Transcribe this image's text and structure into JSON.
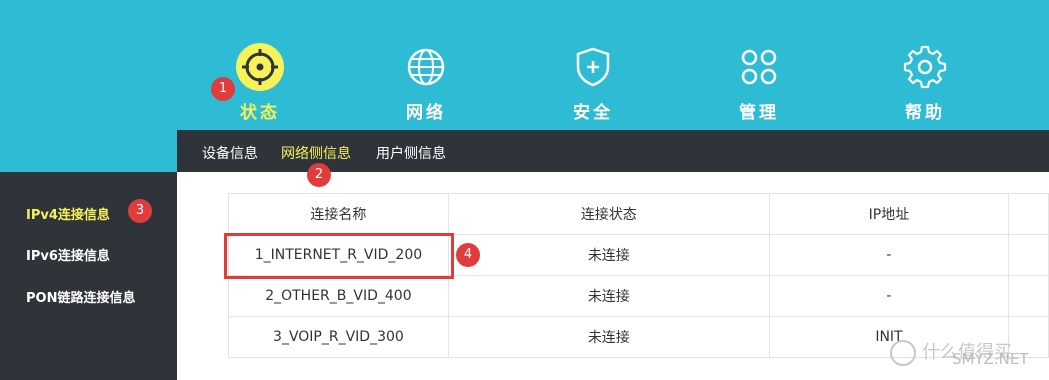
{
  "nav": {
    "items": [
      {
        "label": "状态",
        "icon": "status-target-icon",
        "active": true
      },
      {
        "label": "网络",
        "icon": "globe-icon",
        "active": false
      },
      {
        "label": "安全",
        "icon": "shield-plus-icon",
        "active": false
      },
      {
        "label": "管理",
        "icon": "manage-grid-icon",
        "active": false
      },
      {
        "label": "帮助",
        "icon": "gear-icon",
        "active": false
      }
    ]
  },
  "subnav": {
    "items": [
      "设备信息",
      "网络侧信息",
      "用户侧信息"
    ],
    "active": "网络侧信息"
  },
  "sidebar": {
    "items": [
      "IPv4连接信息",
      "IPv6连接信息",
      "PON链路连接信息"
    ],
    "active": "IPv4连接信息"
  },
  "table": {
    "headers": [
      "连接名称",
      "连接状态",
      "IP地址"
    ],
    "rows": [
      [
        "1_INTERNET_R_VID_200",
        "未连接",
        "-"
      ],
      [
        "2_OTHER_B_VID_400",
        "未连接",
        "-"
      ],
      [
        "3_VOIP_R_VID_300",
        "未连接",
        "INIT"
      ]
    ]
  },
  "annotations": [
    "1",
    "2",
    "3",
    "4"
  ],
  "watermark": {
    "text": "什么值得买",
    "site": "SMYZ.NET"
  },
  "colors": {
    "accent": "#2dbcd4",
    "active": "#f6f25a",
    "dark": "#2f333a",
    "badge": "#e03c3c"
  }
}
